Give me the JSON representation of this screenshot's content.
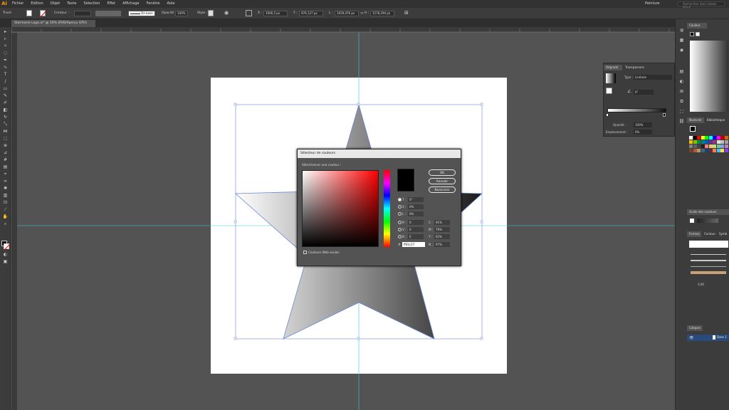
{
  "app": {
    "logo": "Ai"
  },
  "menu": [
    "Fichier",
    "Edition",
    "Objet",
    "Texte",
    "Sélection",
    "Effet",
    "Affichage",
    "Fenêtre",
    "Aide"
  ],
  "workspace": "Peinture",
  "search_placeholder": "Rechercher dans Adobe Stock",
  "control_bar": {
    "selection_label": "Tracé",
    "stroke_label": "Contour :",
    "profile_label": "De base",
    "opacity_label": "Opacité :",
    "opacity_value": "100%",
    "style_label": "Style :",
    "x_label": "X :",
    "x_value": "1006,5 px",
    "y_label": "Y :",
    "y_value": "976,127 px",
    "w_label": "L :",
    "w_value": "1659,476 px",
    "h_label": "H :",
    "h_value": "1578,294 px"
  },
  "document_tab": "Starmasie Logo.ai* @ 50% (RVB/Aperçu GPU)",
  "color_picker": {
    "title": "Sélecteur de couleurs",
    "prompt": "Sélectionner une couleur :",
    "ok": "OK",
    "cancel": "Annuler",
    "swatches": "Nuanciers",
    "web_only": "Couleurs Web seules",
    "hsb": [
      {
        "label": "T :",
        "value": "0°"
      },
      {
        "label": "S :",
        "value": "0%"
      },
      {
        "label": "L :",
        "value": "0%"
      }
    ],
    "rgb": [
      {
        "label": "R :",
        "value": "0"
      },
      {
        "label": "V :",
        "value": "0"
      },
      {
        "label": "B :",
        "value": "0"
      }
    ],
    "cmyk": [
      {
        "label": "C :",
        "value": "91%"
      },
      {
        "label": "M :",
        "value": "79%"
      },
      {
        "label": "Y :",
        "value": "62%"
      },
      {
        "label": "N :",
        "value": "97%"
      }
    ],
    "hex_label": "#",
    "hex_value": "ffd1c17",
    "selected_color": "#000000"
  },
  "gradient_panel": {
    "tab_gradient": "Dégradé",
    "tab_transparency": "Transparence",
    "type_label": "Type :",
    "type_value": "Linéaire",
    "angle_value": "0°",
    "opacity_label": "Opacité :",
    "opacity_value": "100%",
    "location_label": "Emplacement :",
    "location_value": "0%"
  },
  "right_panel": {
    "color_tab": "Couleur",
    "swatches_tab": "Nuancier",
    "libraries_tab": "Bibliothèque",
    "color_guide_tab": "Guide des couleurs",
    "brushes_tab": "Formes",
    "brush_contour_tab": "Contour",
    "symbols_tab": "Symb",
    "brush_size": "3,00",
    "layers_tab": "Calques",
    "layer_name": "Dans 1"
  },
  "colors": {
    "accent": "#1a73e8",
    "ai_orange": "#ff9a00",
    "guide": "#3fc6e8"
  }
}
